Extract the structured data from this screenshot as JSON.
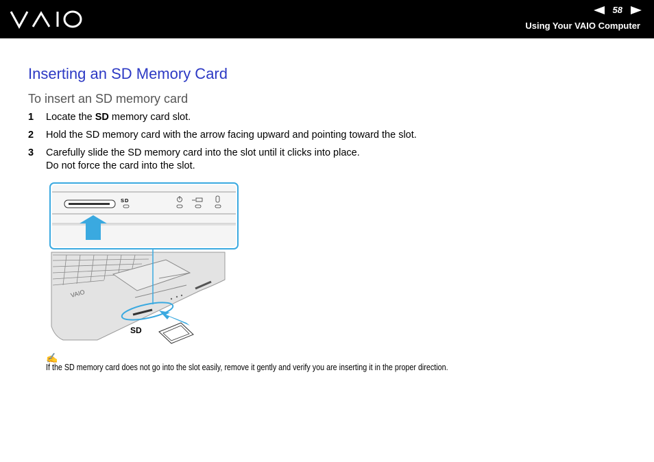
{
  "header": {
    "brand": "VAIO",
    "page_number": "58",
    "section_title": "Using Your VAIO Computer"
  },
  "title": "Inserting an SD Memory Card",
  "subtitle": "To insert an SD memory card",
  "steps": [
    {
      "num": "1",
      "pre": "Locate the ",
      "bold": "SD",
      "post": " memory card slot."
    },
    {
      "num": "2",
      "text": "Hold the SD memory card with the arrow facing upward and pointing toward the slot."
    },
    {
      "num": "3",
      "line1": "Carefully slide the SD memory card into the slot until it clicks into place.",
      "line2": "Do not force the card into the slot."
    }
  ],
  "figure": {
    "slot_label": "SD",
    "callout_label": "SD"
  },
  "note": {
    "icon": "note-pencil-icon",
    "text": "If the SD memory card does not go into the slot easily, remove it gently and verify you are inserting it in the proper direction."
  },
  "colors": {
    "heading_blue": "#2c39c4",
    "callout_blue": "#3aa9e0"
  }
}
